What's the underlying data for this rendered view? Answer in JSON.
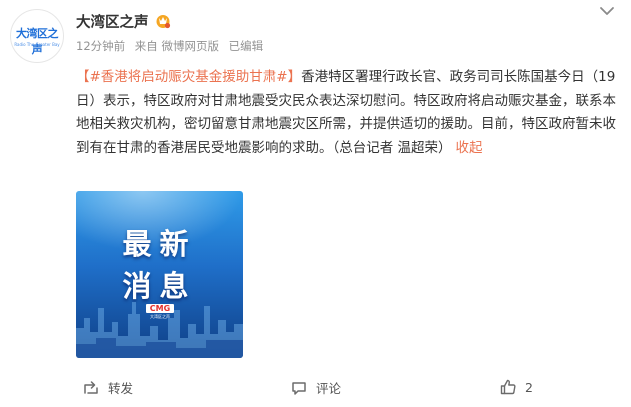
{
  "account": {
    "name": "大湾区之声",
    "avatar_text": "大湾区之声",
    "avatar_subtext": "Radio The Greater Bay"
  },
  "post_meta": {
    "time": "12分钟前",
    "source": "来自 微博网页版",
    "edited": "已编辑"
  },
  "post": {
    "topic": "【#香港将启动赈灾基金援助甘肃#】",
    "body": "香港特区署理行政长官、政务司司长陈国基今日（19日）表示，特区政府对甘肃地震受灾民众表达深切慰问。特区政府将启动赈灾基金，联系本地相关救灾机构，密切留意甘肃地震灾区所需，并提供适切的援助。目前，特区政府暂未收到有在甘肃的香港居民受地震影响的求助。（总台记者 温超荣）",
    "collapse_label": "收起"
  },
  "media": {
    "headline_1": "最新",
    "headline_2": "消息",
    "brand": "CMG",
    "station": "大湾区之声"
  },
  "actions": {
    "repost_label": "转发",
    "comment_label": "评论",
    "like_count": "2"
  },
  "colors": {
    "topic": "#eb7350",
    "meta": "#939393",
    "vip_badge": "#f5a623",
    "media_blue": "#1f6fc9"
  },
  "icons": {
    "more": "chevron-down-icon",
    "vip": "vip-badge-icon",
    "repost": "repost-icon",
    "comment": "comment-icon",
    "like": "thumbs-up-icon"
  }
}
